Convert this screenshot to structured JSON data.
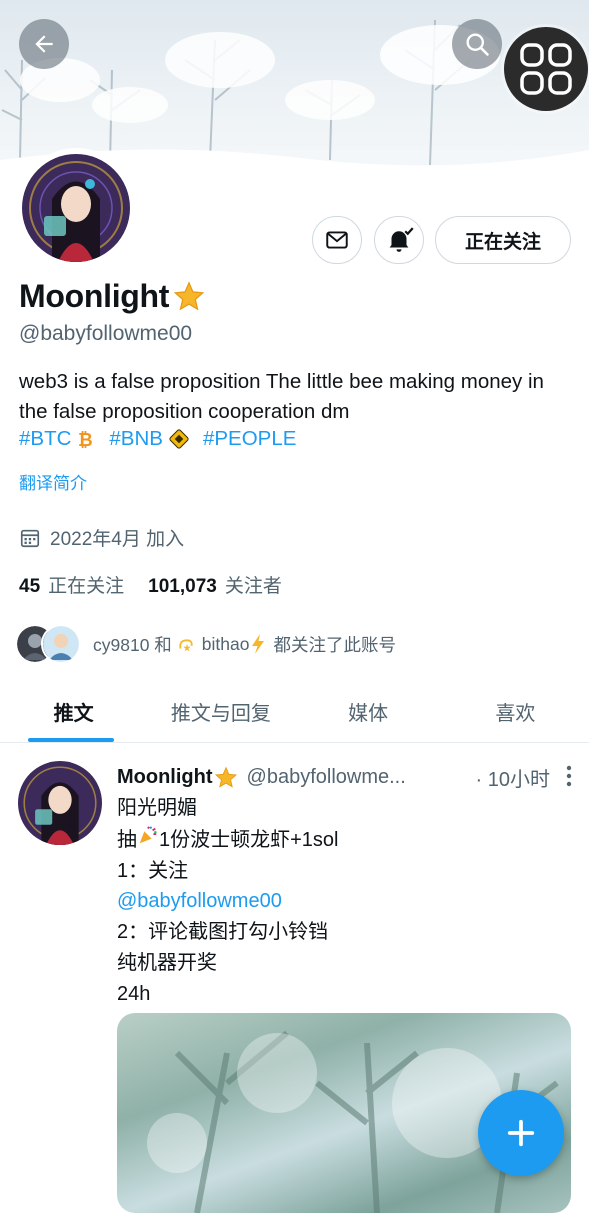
{
  "profile": {
    "name": "Moonlight",
    "handle": "@babyfollowme00",
    "bio": "web3 is a false proposition  The little bee making money in the false proposition cooperation dm",
    "hashtags": [
      "#BTC",
      "#BNB",
      "#PEOPLE"
    ],
    "translate_label": "翻译简介",
    "joined": "2022年4月 加入",
    "following_count": "45",
    "following_label": "正在关注",
    "followers_count": "101,073",
    "followers_label": "关注者",
    "followed_by_text_1": "cy9810 和",
    "followed_by_text_2": "bithao",
    "followed_by_text_3": "都关注了此账号"
  },
  "buttons": {
    "follow_label": "正在关注",
    "back": "back-arrow-icon",
    "search": "search-icon",
    "message": "mail-icon",
    "notify": "bell-icon",
    "compose": "plus-icon"
  },
  "tabs": [
    {
      "label": "推文",
      "active": true
    },
    {
      "label": "推文与回复",
      "active": false
    },
    {
      "label": "媒体",
      "active": false
    },
    {
      "label": "喜欢",
      "active": false
    }
  ],
  "tweet": {
    "name": "Moonlight",
    "handle": "@babyfollowme...",
    "time": "· 10小时",
    "lines": [
      "阳光明媚",
      "抽",
      "1份波士顿龙虾+1sol",
      "1：关注",
      "@babyfollowme00",
      "2：评论截图打勾小铃铛",
      "纯机器开奖",
      "24h"
    ]
  },
  "colors": {
    "accent": "#1d9bf0",
    "text": "#0f1419",
    "muted": "#536471"
  }
}
